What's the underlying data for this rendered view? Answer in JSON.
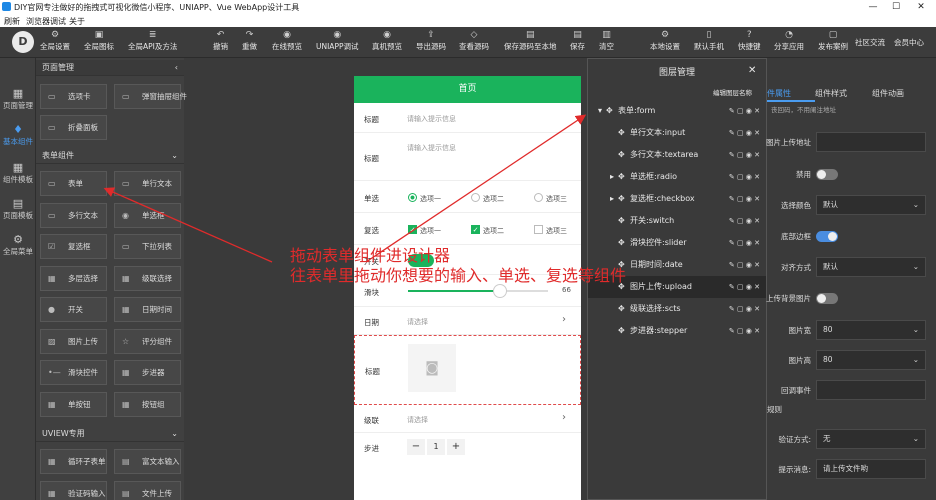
{
  "window": {
    "title": "DIY官网专注做好的拖拽式可视化微信小程序、UNIAPP、Vue WebApp设计工具",
    "min": "—",
    "max": "☐",
    "close": "✕"
  },
  "menubar": [
    "刷新",
    "浏览器调试",
    "关于"
  ],
  "toolbar": {
    "logo": "D",
    "left": [
      {
        "icon": "⚙",
        "label": "全局设置"
      },
      {
        "icon": "▣",
        "label": "全局图标"
      },
      {
        "icon": "≣",
        "label": "全局API及方法"
      }
    ],
    "center": [
      {
        "icon": "↶",
        "label": "撤销"
      },
      {
        "icon": "↷",
        "label": "重做"
      },
      {
        "icon": "◉",
        "label": "在线预览"
      },
      {
        "icon": "◉",
        "label": "UNIAPP调试"
      },
      {
        "icon": "◉",
        "label": "真机预览"
      },
      {
        "icon": "⇪",
        "label": "导出源码"
      },
      {
        "icon": "◇",
        "label": "查看源码"
      },
      {
        "icon": "▤",
        "label": "保存源码至本地"
      },
      {
        "icon": "▤",
        "label": "保存"
      },
      {
        "icon": "▥",
        "label": "清空"
      }
    ],
    "right": [
      {
        "icon": "⚙",
        "label": "本地设置"
      },
      {
        "icon": "▯",
        "label": "默认手机"
      },
      {
        "icon": "?",
        "label": "快捷键"
      },
      {
        "icon": "◔",
        "label": "分享应用"
      },
      {
        "icon": "▢",
        "label": "发布案例"
      },
      {
        "icon": "",
        "label": "社区交流"
      },
      {
        "icon": "",
        "label": "会员中心"
      }
    ]
  },
  "leftnav": [
    {
      "icon": "▦",
      "label": "页面管理"
    },
    {
      "icon": "♦",
      "label": "基本组件"
    },
    {
      "icon": "▦",
      "label": "组件模板"
    },
    {
      "icon": "▤",
      "label": "页面模板"
    },
    {
      "icon": "⚙",
      "label": "全局菜单"
    }
  ],
  "comp_panel": {
    "header": "页面管理",
    "collapse": "‹",
    "top_items": [
      {
        "icon": "▭",
        "label": "选项卡"
      },
      {
        "icon": "▭",
        "label": "弹窗抽屉组件"
      },
      {
        "icon": "▭",
        "label": "折叠面板"
      }
    ],
    "form_section": "表单组件",
    "form_items": [
      {
        "icon": "▭",
        "label": "表单"
      },
      {
        "icon": "▭",
        "label": "单行文本"
      },
      {
        "icon": "▭",
        "label": "多行文本"
      },
      {
        "icon": "◉",
        "label": "单选框"
      },
      {
        "icon": "☑",
        "label": "复选框"
      },
      {
        "icon": "▭",
        "label": "下拉列表"
      },
      {
        "icon": "▦",
        "label": "多层选择"
      },
      {
        "icon": "▦",
        "label": "级联选择"
      },
      {
        "icon": "●",
        "label": "开关"
      },
      {
        "icon": "▦",
        "label": "日期时间"
      },
      {
        "icon": "▨",
        "label": "图片上传"
      },
      {
        "icon": "☆",
        "label": "评分组件"
      },
      {
        "icon": "•—",
        "label": "滑块控件"
      },
      {
        "icon": "▦",
        "label": "步进器"
      },
      {
        "icon": "▦",
        "label": "单按钮"
      },
      {
        "icon": "▦",
        "label": "按钮组"
      }
    ],
    "uview_section": "UVIEW专用",
    "uview_items": [
      {
        "icon": "▦",
        "label": "循环子表单"
      },
      {
        "icon": "▤",
        "label": "富文本输入"
      },
      {
        "icon": "▦",
        "label": "验证码输入"
      },
      {
        "icon": "▤",
        "label": "文件上传"
      }
    ]
  },
  "phone": {
    "title": "首页",
    "title_input": {
      "label": "标题",
      "placeholder": "请输入提示信息"
    },
    "title_textarea": {
      "label": "标题",
      "placeholder": "请输入提示信息"
    },
    "radio": {
      "label": "单选",
      "options": [
        "选项一",
        "选项二",
        "选项三"
      ],
      "selected": 0
    },
    "checkbox": {
      "label": "复选",
      "options": [
        "选项一",
        "选项二",
        "选项三"
      ],
      "checked": [
        true,
        true,
        false
      ]
    },
    "switch": {
      "label": "开关",
      "on": true
    },
    "slider": {
      "label": "滑块",
      "value": 66,
      "max": 100
    },
    "date": {
      "label": "日期",
      "placeholder": "请选择"
    },
    "upload": {
      "label": "标题"
    },
    "cascade": {
      "label": "级联",
      "placeholder": "请选择"
    },
    "stepper": {
      "label": "步进",
      "minus": "−",
      "value": "1",
      "plus": "+"
    }
  },
  "layers": {
    "title": "图层管理",
    "close": "✕",
    "edit_name": "编辑图层名称",
    "rows": [
      {
        "label": "表单:form",
        "indent": 0,
        "expand": "▾",
        "selected": false
      },
      {
        "label": "单行文本:input",
        "indent": 1,
        "expand": "",
        "selected": false
      },
      {
        "label": "多行文本:textarea",
        "indent": 1,
        "expand": "",
        "selected": false
      },
      {
        "label": "单选框:radio",
        "indent": 1,
        "expand": "▸",
        "selected": false
      },
      {
        "label": "复选框:checkbox",
        "indent": 1,
        "expand": "▸",
        "selected": false
      },
      {
        "label": "开关:switch",
        "indent": 1,
        "expand": "",
        "selected": false
      },
      {
        "label": "滑块控件:slider",
        "indent": 1,
        "expand": "",
        "selected": false
      },
      {
        "label": "日期时间:date",
        "indent": 1,
        "expand": "",
        "selected": false
      },
      {
        "label": "图片上传:upload",
        "indent": 1,
        "expand": "",
        "selected": true
      },
      {
        "label": "级联选择:scts",
        "indent": 1,
        "expand": "",
        "selected": false
      },
      {
        "label": "步进器:stepper",
        "indent": 1,
        "expand": "",
        "selected": false
      }
    ],
    "ops": "✎ ▢ ◉ ✕"
  },
  "props": {
    "tabs": [
      "件属性",
      "组件样式",
      "组件动画"
    ],
    "note": "丧回码，不用阑注地址",
    "rows": [
      {
        "label": "图片上传地址",
        "type": "input",
        "value": ""
      },
      {
        "label": "禁用",
        "type": "toggle",
        "on": false
      },
      {
        "label": "选择颜色",
        "type": "select",
        "value": "默认"
      },
      {
        "label": "底部边框",
        "type": "toggle",
        "on": true
      },
      {
        "label": "对齐方式",
        "type": "select",
        "value": "默认"
      },
      {
        "label": "上传背景图片",
        "type": "toggle",
        "on": false
      },
      {
        "label": "图片宽",
        "type": "select",
        "value": "80"
      },
      {
        "label": "图片高",
        "type": "select",
        "value": "80"
      },
      {
        "label": "回调事件",
        "type": "input",
        "value": ""
      }
    ],
    "rule_section": "规则",
    "rule_rows": [
      {
        "label": "验证方式:",
        "type": "select",
        "value": "无"
      },
      {
        "label": "提示消息:",
        "type": "input",
        "value": "请上传文件哟"
      }
    ]
  },
  "annotation": {
    "line1": "拖动表单组件进设计器",
    "line2": "往表单里拖动你想要的输入、单选、复选等组件"
  }
}
